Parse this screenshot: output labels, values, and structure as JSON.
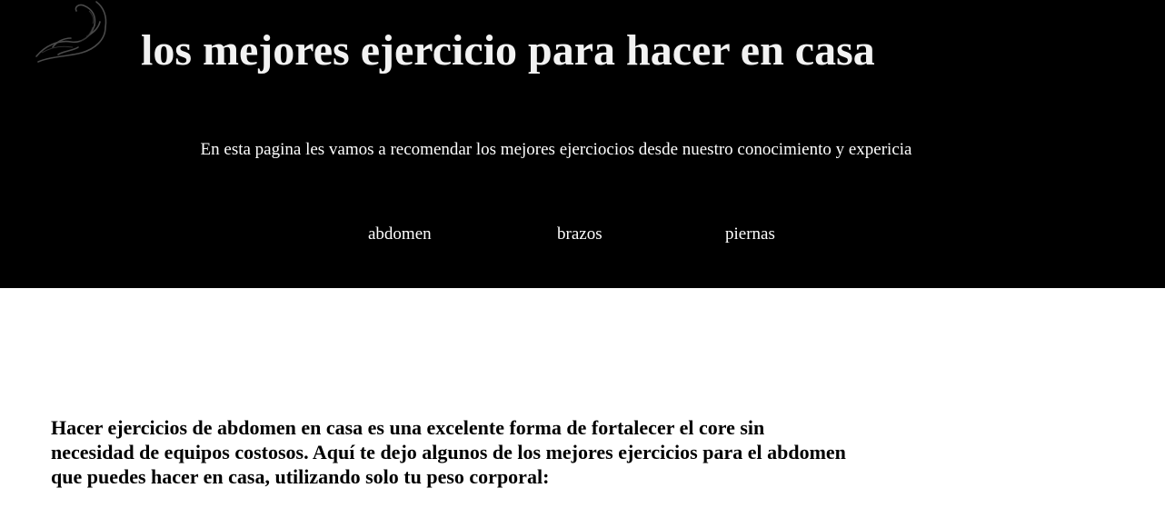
{
  "header": {
    "title": "los mejores ejercicio para hacer en casa",
    "logo_icon": "flexed-arm-icon",
    "intro": "En esta pagina les vamos a recomendar los mejores ejerciocios desde nuestro conocimiento y expericia",
    "background_color": "#000000",
    "text_color": "#ffffff"
  },
  "nav": {
    "items": [
      {
        "label": "abdomen"
      },
      {
        "label": "brazos"
      },
      {
        "label": "piernas"
      }
    ]
  },
  "main": {
    "paragraph": "Hacer ejercicios de abdomen en casa es una excelente forma de fortalecer el core sin necesidad de equipos costosos. Aquí te dejo algunos de los mejores ejercicios para el abdomen que puedes hacer en casa, utilizando solo tu peso corporal:"
  }
}
